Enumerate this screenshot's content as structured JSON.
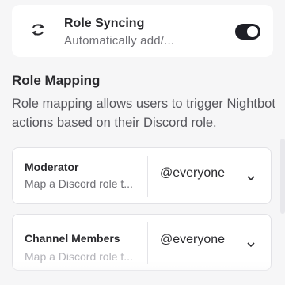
{
  "role_syncing": {
    "title": "Role Syncing",
    "subtitle": "Automatically add/...",
    "toggle_enabled": true
  },
  "role_mapping": {
    "title": "Role Mapping",
    "description": "Role mapping allows users to trigger Nightbot actions based on their Discord role."
  },
  "mappings": [
    {
      "role": "Moderator",
      "hint": "Map a Discord role t...",
      "selected": "@everyone"
    },
    {
      "role": "Channel Members",
      "hint": "Map a Discord role t...",
      "selected": "@everyone"
    }
  ],
  "colors": {
    "toggle_on": "#1e1f26",
    "background": "#f6f6f7",
    "card": "#ffffff"
  }
}
